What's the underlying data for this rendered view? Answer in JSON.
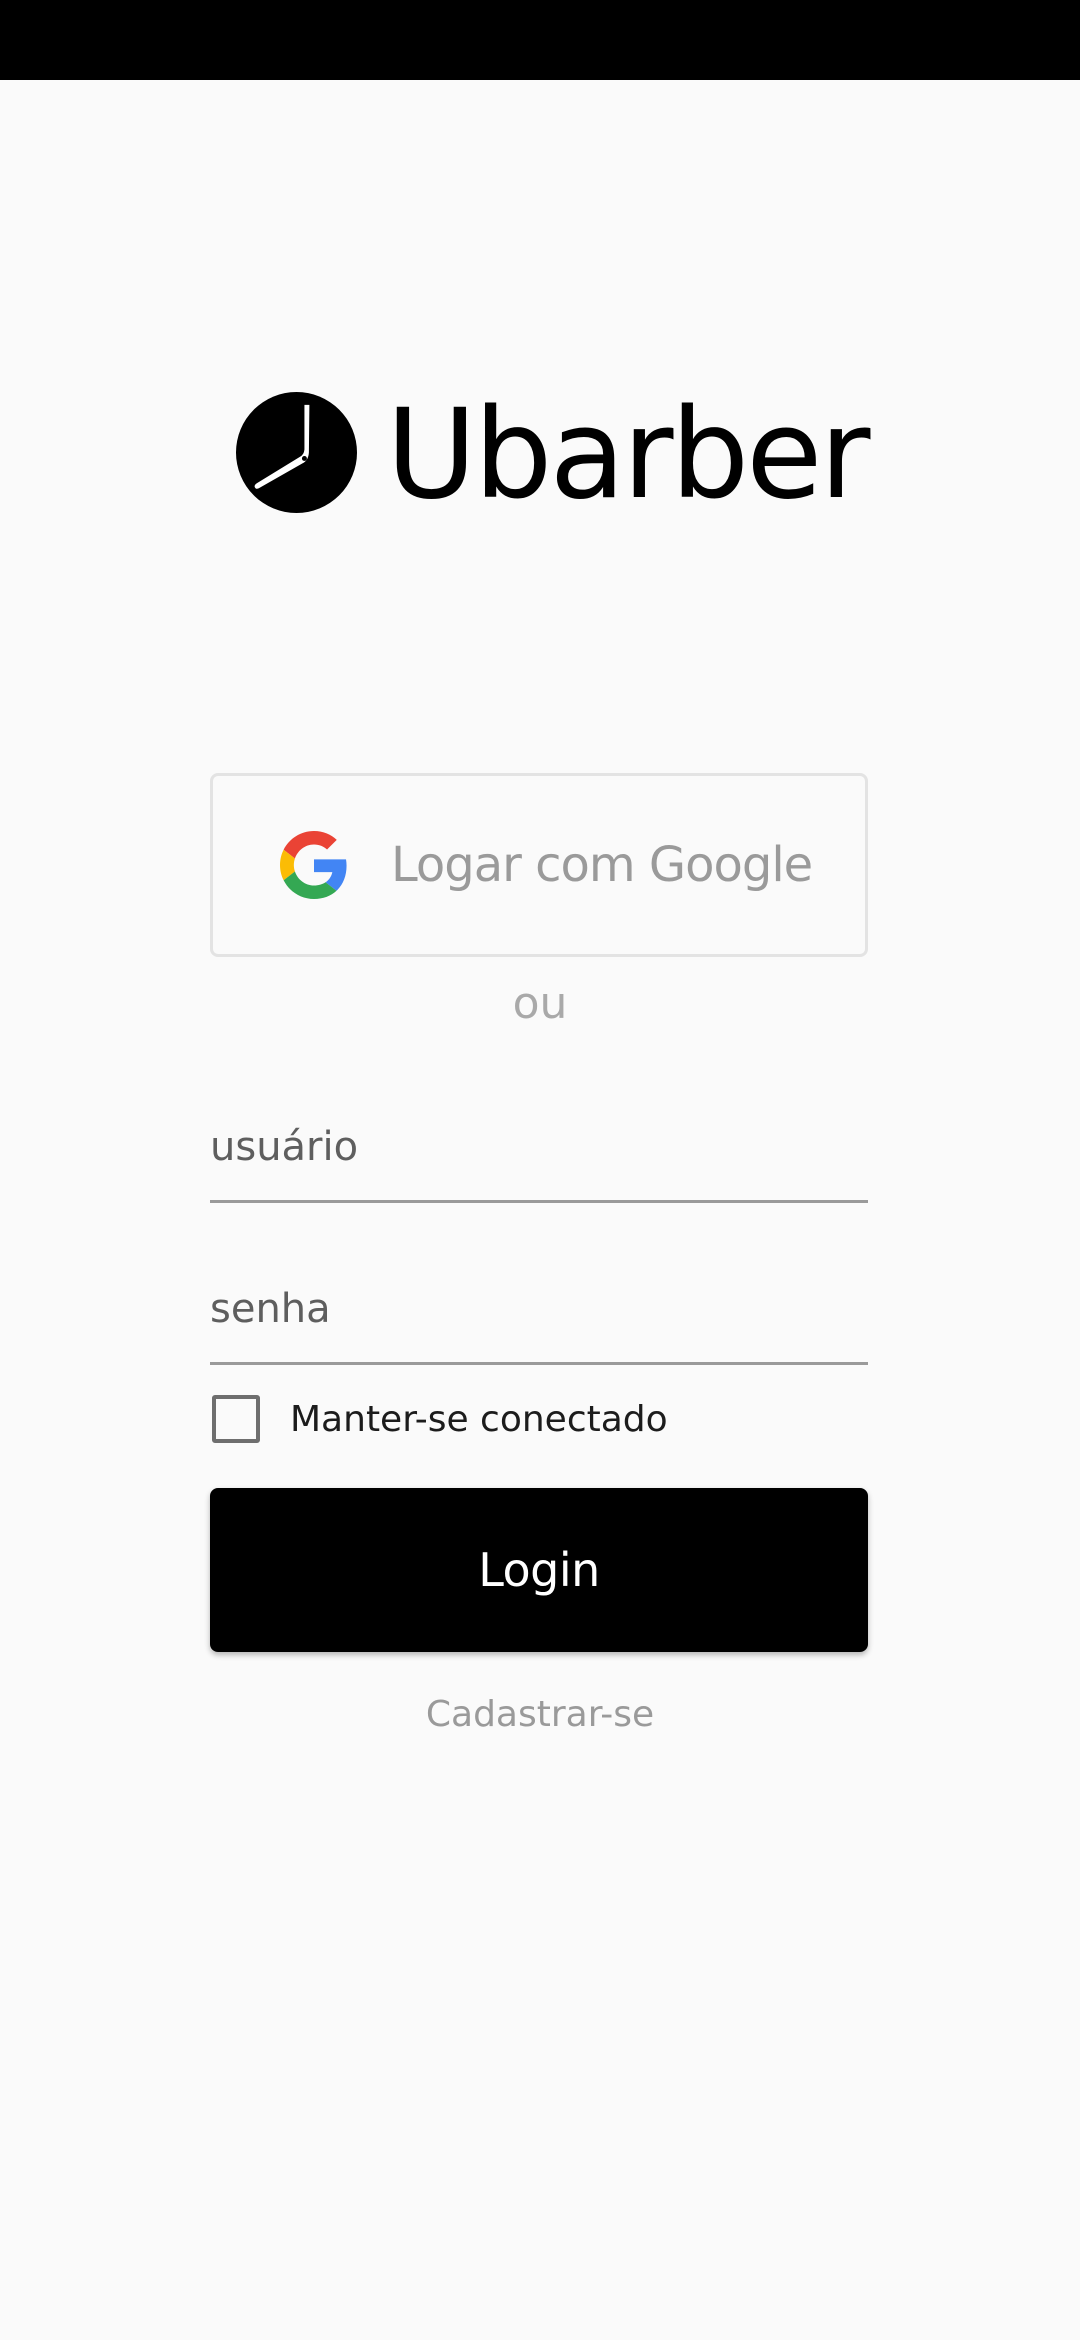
{
  "app": {
    "brand_name": "Ubarber",
    "logo_icon": "clock-razor-icon"
  },
  "google_login": {
    "label": "Logar com Google",
    "icon": "google-g-icon"
  },
  "divider": {
    "text": "ou"
  },
  "form": {
    "username_placeholder": "usuário",
    "username_value": "",
    "password_placeholder": "senha",
    "password_value": "",
    "remember_label": "Manter-se conectado",
    "remember_checked": false,
    "login_label": "Login",
    "signup_label": "Cadastrar-se"
  },
  "colors": {
    "background": "#fafafa",
    "primary": "#000000",
    "muted_text": "#9a9a9a",
    "border": "#e3e3e3"
  }
}
